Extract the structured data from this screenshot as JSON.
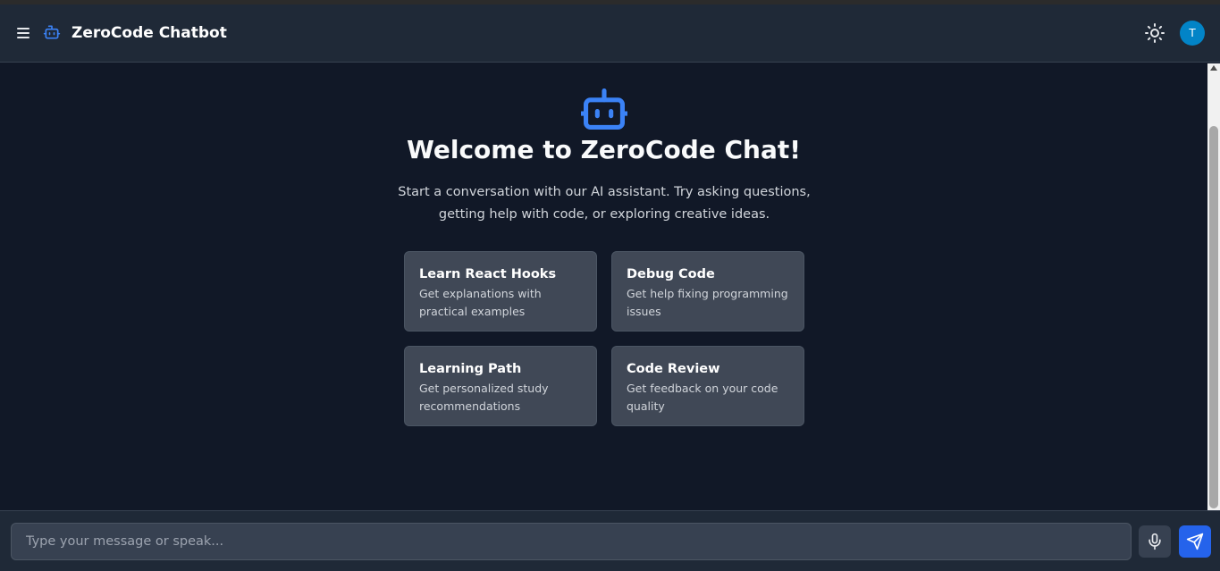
{
  "header": {
    "title": "ZeroCode Chatbot",
    "avatar_initial": "T"
  },
  "welcome": {
    "heading": "Welcome to ZeroCode Chat!",
    "intro": "Start a conversation with our AI assistant. Try asking questions, getting help with code, or exploring creative ideas."
  },
  "suggestions": [
    {
      "title": "Learn React Hooks",
      "desc": "Get explanations with practical examples"
    },
    {
      "title": "Debug Code",
      "desc": "Get help fixing programming issues"
    },
    {
      "title": "Learning Path",
      "desc": "Get personalized study recommendations"
    },
    {
      "title": "Code Review",
      "desc": "Get feedback on your code quality"
    }
  ],
  "composer": {
    "placeholder": "Type your message or speak..."
  },
  "colors": {
    "accent": "#2563eb",
    "avatar": "#0284c7",
    "background": "#111827",
    "panel": "#1f2937",
    "card": "#404856"
  },
  "icons": {
    "menu": "menu-icon",
    "brand": "bot-icon",
    "theme": "sun-icon",
    "mic": "microphone-icon",
    "send": "send-icon"
  }
}
